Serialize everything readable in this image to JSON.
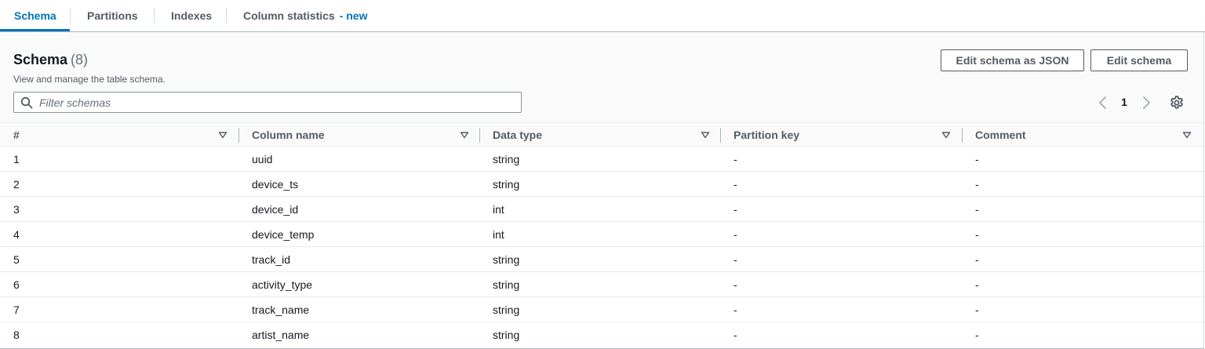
{
  "tabs": [
    {
      "label": "Schema",
      "active": true
    },
    {
      "label": "Partitions"
    },
    {
      "label": "Indexes"
    },
    {
      "label": "Column statistics",
      "badge": "- new"
    }
  ],
  "panel": {
    "title": "Schema",
    "count": "(8)",
    "description": "View and manage the table schema.",
    "buttons": {
      "edit_json": "Edit schema as JSON",
      "edit": "Edit schema"
    },
    "search": {
      "placeholder": "Filter schemas",
      "value": ""
    },
    "pagination": {
      "current_page": "1"
    }
  },
  "table": {
    "columns": [
      "#",
      "Column name",
      "Data type",
      "Partition key",
      "Comment"
    ],
    "rows": [
      [
        "1",
        "uuid",
        "string",
        "-",
        "-"
      ],
      [
        "2",
        "device_ts",
        "string",
        "-",
        "-"
      ],
      [
        "3",
        "device_id",
        "int",
        "-",
        "-"
      ],
      [
        "4",
        "device_temp",
        "int",
        "-",
        "-"
      ],
      [
        "5",
        "track_id",
        "string",
        "-",
        "-"
      ],
      [
        "6",
        "activity_type",
        "string",
        "-",
        "-"
      ],
      [
        "7",
        "track_name",
        "string",
        "-",
        "-"
      ],
      [
        "8",
        "artist_name",
        "string",
        "-",
        "-"
      ]
    ]
  },
  "colors": {
    "accent": "#0073bb",
    "text": "#16191f",
    "muted": "#545b64",
    "header_bg": "#fafafa",
    "border": "#eaeded"
  },
  "icons": {
    "search": "search-icon",
    "prev": "chevron-left-icon",
    "next": "chevron-right-icon",
    "settings": "gear-icon",
    "sort": "caret-down-icon"
  }
}
